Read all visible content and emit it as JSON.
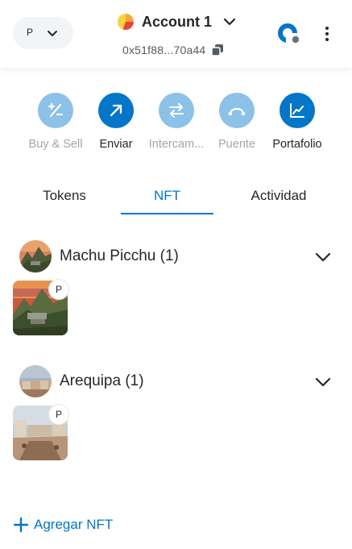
{
  "header": {
    "network_letter": "P",
    "account_name": "Account 1",
    "address": "0x51f88...70a44"
  },
  "actions": [
    {
      "label": "Buy & Sell",
      "icon": "buy-sell-icon",
      "enabled": false
    },
    {
      "label": "Enviar",
      "icon": "send-arrow-icon",
      "enabled": true
    },
    {
      "label": "Intercam...",
      "icon": "swap-icon",
      "enabled": false
    },
    {
      "label": "Puente",
      "icon": "bridge-icon",
      "enabled": false
    },
    {
      "label": "Portafolio",
      "icon": "portfolio-chart-icon",
      "enabled": true
    }
  ],
  "tabs": [
    {
      "label": "Tokens",
      "active": false
    },
    {
      "label": "NFT",
      "active": true
    },
    {
      "label": "Actividad",
      "active": false
    }
  ],
  "collections": [
    {
      "title": "Machu Picchu (1)",
      "badge": "P"
    },
    {
      "title": "Arequipa (1)",
      "badge": "P"
    }
  ],
  "add_nft_label": "Agregar NFT",
  "colors": {
    "accent": "#0376c9",
    "accent_muted": "#8cc1e8",
    "text": "#24272a",
    "muted_text": "#9fa6ae"
  }
}
